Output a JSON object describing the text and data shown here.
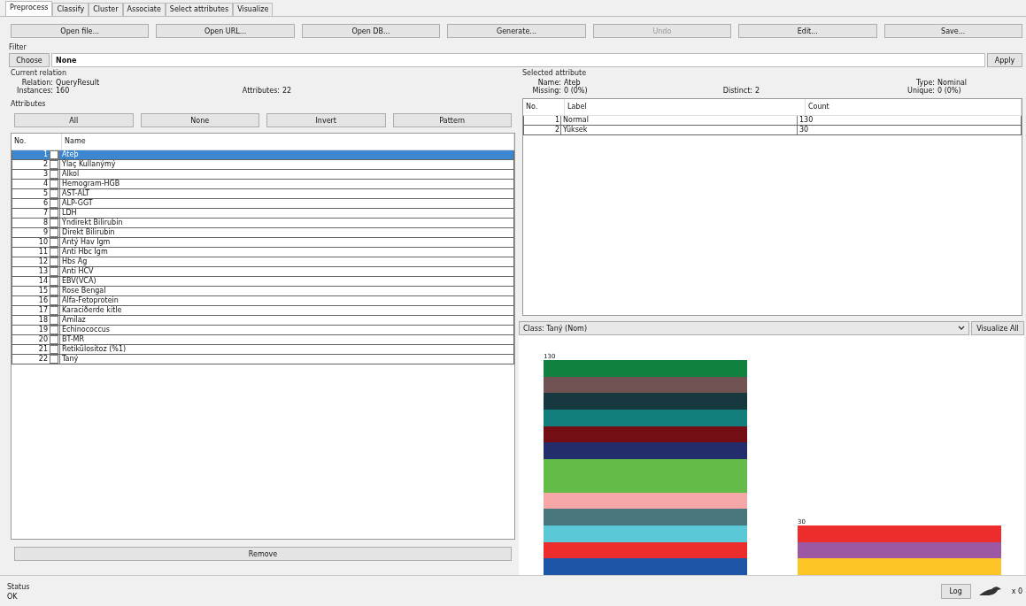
{
  "tabs": [
    {
      "label": "Preprocess",
      "selected": true
    },
    {
      "label": "Classify",
      "selected": false
    },
    {
      "label": "Cluster",
      "selected": false
    },
    {
      "label": "Associate",
      "selected": false
    },
    {
      "label": "Select attributes",
      "selected": false
    },
    {
      "label": "Visualize",
      "selected": false
    }
  ],
  "toolbar": [
    {
      "label": "Open file...",
      "disabled": false
    },
    {
      "label": "Open URL...",
      "disabled": false
    },
    {
      "label": "Open DB...",
      "disabled": false
    },
    {
      "label": "Generate...",
      "disabled": false
    },
    {
      "label": "Undo",
      "disabled": true
    },
    {
      "label": "Edit...",
      "disabled": false
    },
    {
      "label": "Save...",
      "disabled": false
    }
  ],
  "filter": {
    "title": "Filter",
    "button": "Choose",
    "value": "None",
    "apply": "Apply"
  },
  "current_relation": {
    "title": "Current relation",
    "relation_label": "Relation:",
    "relation": "QueryResult",
    "instances_label": "Instances:",
    "instances": "160",
    "attributes_label": "Attributes:",
    "attributes": "22"
  },
  "attributes": {
    "title": "Attributes",
    "buttons": [
      "All",
      "None",
      "Invert",
      "Pattern"
    ],
    "columns": [
      "No.",
      "Name"
    ],
    "rows": [
      {
        "no": "1",
        "name": "Ateþ",
        "checked": false,
        "selected": true
      },
      {
        "no": "2",
        "name": "Ýlaç Kullanýmý",
        "checked": false,
        "selected": false
      },
      {
        "no": "3",
        "name": "Alkol",
        "checked": false,
        "selected": false
      },
      {
        "no": "4",
        "name": "Hemogram-HGB",
        "checked": false,
        "selected": false
      },
      {
        "no": "5",
        "name": "AST-ALT",
        "checked": false,
        "selected": false
      },
      {
        "no": "6",
        "name": "ALP-GGT",
        "checked": false,
        "selected": false
      },
      {
        "no": "7",
        "name": "LDH",
        "checked": false,
        "selected": false
      },
      {
        "no": "8",
        "name": "Ýndirekt Bilirubin",
        "checked": false,
        "selected": false
      },
      {
        "no": "9",
        "name": "Direkt Bilirubin",
        "checked": false,
        "selected": false
      },
      {
        "no": "10",
        "name": "Antý Hav Igm",
        "checked": false,
        "selected": false
      },
      {
        "no": "11",
        "name": "Anti Hbc Igm",
        "checked": false,
        "selected": false
      },
      {
        "no": "12",
        "name": "Hbs Ag",
        "checked": false,
        "selected": false
      },
      {
        "no": "13",
        "name": "Anti HCV",
        "checked": false,
        "selected": false
      },
      {
        "no": "14",
        "name": "EBV(VCA)",
        "checked": false,
        "selected": false
      },
      {
        "no": "15",
        "name": "Rose Bengal",
        "checked": false,
        "selected": false
      },
      {
        "no": "16",
        "name": "Alfa-Fetoprotein",
        "checked": false,
        "selected": false
      },
      {
        "no": "17",
        "name": "Karaciðerde kitle",
        "checked": false,
        "selected": false
      },
      {
        "no": "18",
        "name": "Amilaz",
        "checked": false,
        "selected": false
      },
      {
        "no": "19",
        "name": "Echinococcus",
        "checked": false,
        "selected": false
      },
      {
        "no": "20",
        "name": "BT-MR",
        "checked": false,
        "selected": false
      },
      {
        "no": "21",
        "name": "Retikülositoz (%1)",
        "checked": false,
        "selected": false
      },
      {
        "no": "22",
        "name": "Taný",
        "checked": false,
        "selected": false
      }
    ],
    "remove": "Remove"
  },
  "selected_attribute": {
    "title": "Selected attribute",
    "name_label": "Name:",
    "name": "Ateþ",
    "type_label": "Type:",
    "type": "Nominal",
    "missing_label": "Missing:",
    "missing": "0 (0%)",
    "distinct_label": "Distinct:",
    "distinct": "2",
    "unique_label": "Unique:",
    "unique": "0 (0%)",
    "columns": [
      "No.",
      "Label",
      "Count"
    ],
    "rows": [
      {
        "no": "1",
        "label": "Normal",
        "count": "130"
      },
      {
        "no": "2",
        "label": "Yüksek",
        "count": "30"
      }
    ]
  },
  "class_select": {
    "value": "Class: Taný (Nom)",
    "button": "Visualize All"
  },
  "class_chart": {
    "bars": [
      {
        "label": "130",
        "segments": [
          {
            "color": "#10813e",
            "kind": "single"
          },
          {
            "color": "#725354",
            "kind": "single"
          },
          {
            "color": "#16383e",
            "kind": "single"
          },
          {
            "color": "#137e7c",
            "kind": "single"
          },
          {
            "color": "#730f14",
            "kind": "single"
          },
          {
            "color": "#242d6c",
            "kind": "single"
          },
          {
            "color": "#63bc47",
            "kind": "double"
          },
          {
            "color": "#f5a7a8",
            "kind": "single"
          },
          {
            "color": "#47777c",
            "kind": "single"
          },
          {
            "color": "#5bc8d7",
            "kind": "single"
          },
          {
            "color": "#ec2d2b",
            "kind": "single"
          },
          {
            "color": "#1d56a6",
            "kind": "single"
          }
        ]
      },
      {
        "label": "30",
        "segments": [
          {
            "color": "#ec2d2b",
            "kind": "single"
          },
          {
            "color": "#9c58a2",
            "kind": "single"
          },
          {
            "color": "#fec526",
            "kind": "single"
          }
        ]
      }
    ]
  },
  "status": {
    "title": "Status",
    "text": "OK",
    "log": "Log",
    "count": "x 0"
  }
}
